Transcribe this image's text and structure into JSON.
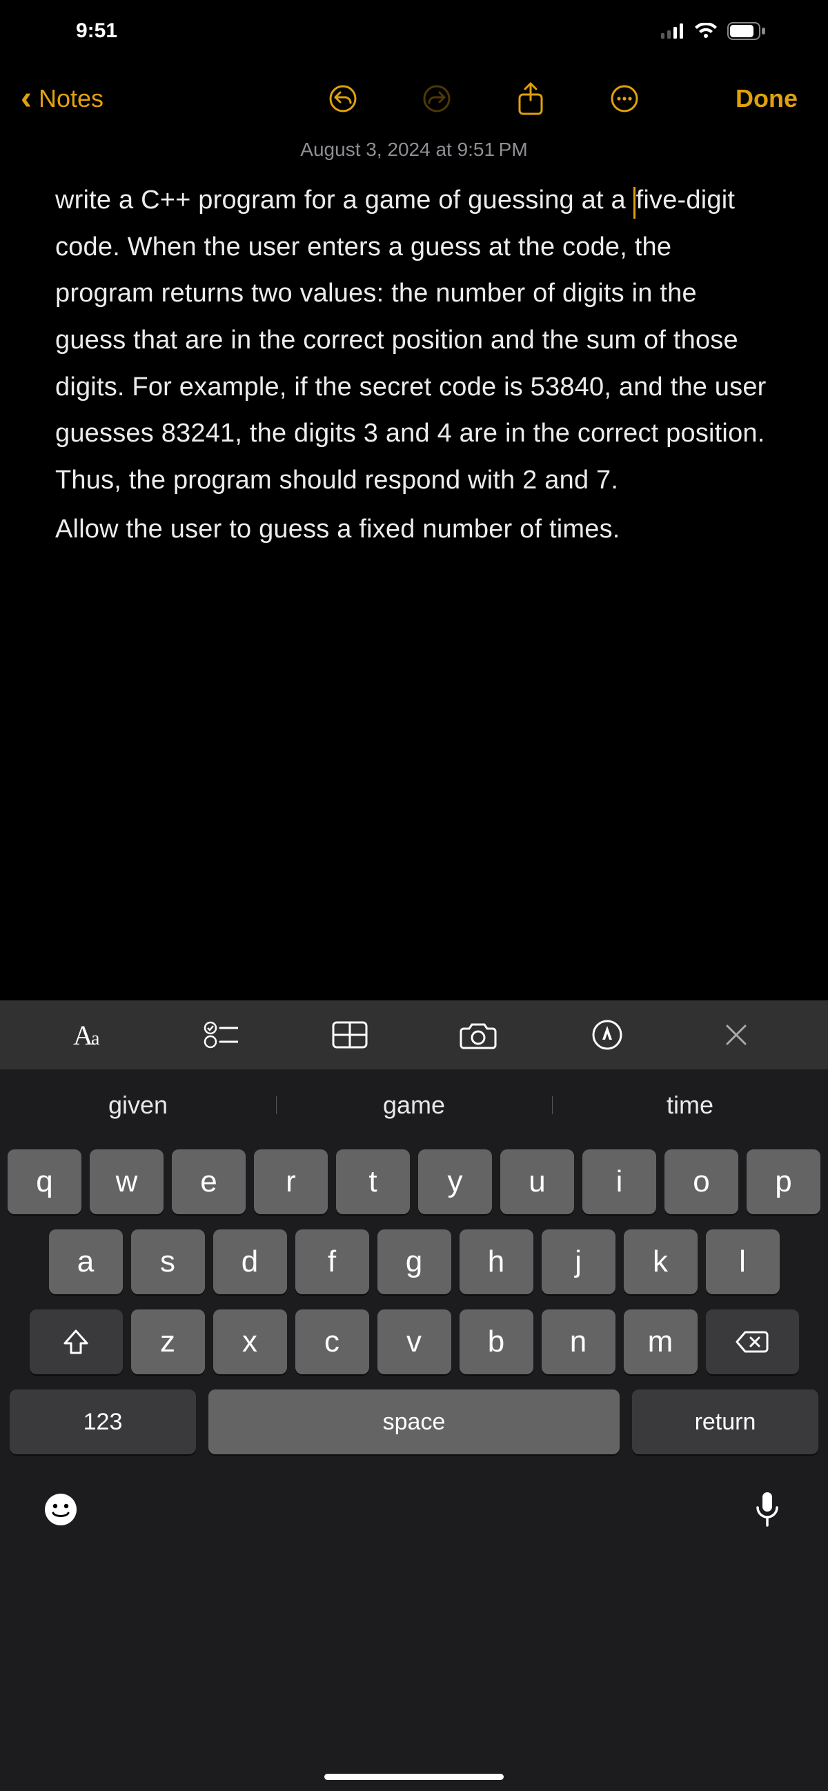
{
  "status": {
    "time": "9:51"
  },
  "nav": {
    "back_label": "Notes",
    "done_label": "Done"
  },
  "note": {
    "date": "August 3, 2024 at 9:51 PM",
    "body_before_caret": "write a C++ program for a game of guessing at a ",
    "body_after_caret": "five-digit code. When the user enters a guess at the code, the program returns two values: the number of digits in the guess that are in the correct position and the sum of those digits. For example, if the secret code is 53840, and the user guesses 83241, the digits 3 and 4 are in the correct position. Thus, the program should respond with 2 and 7.",
    "body_line2": "Allow the user to guess a fixed number of times."
  },
  "keyboard": {
    "suggestions": [
      "given",
      "game",
      "time"
    ],
    "row1": [
      "q",
      "w",
      "e",
      "r",
      "t",
      "y",
      "u",
      "i",
      "o",
      "p"
    ],
    "row2": [
      "a",
      "s",
      "d",
      "f",
      "g",
      "h",
      "j",
      "k",
      "l"
    ],
    "row3": [
      "z",
      "x",
      "c",
      "v",
      "b",
      "n",
      "m"
    ],
    "num_label": "123",
    "space_label": "space",
    "return_label": "return"
  }
}
